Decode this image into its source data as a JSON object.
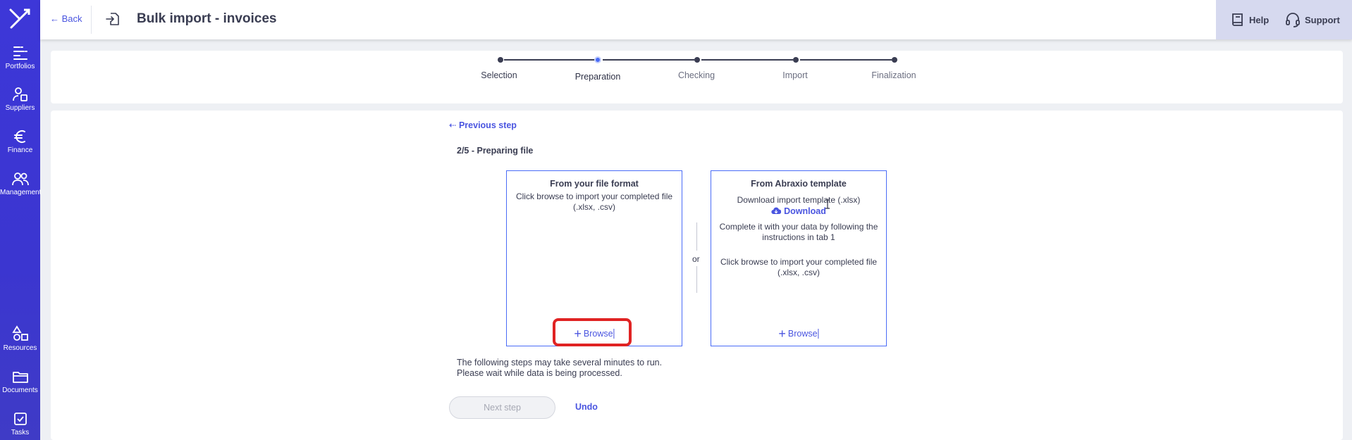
{
  "header": {
    "back_label": "Back",
    "title": "Bulk import - invoices",
    "help_label": "Help",
    "support_label": "Support"
  },
  "sidebar": {
    "items": [
      {
        "label": "Portfolios",
        "icon": "portfolios-icon"
      },
      {
        "label": "Suppliers",
        "icon": "suppliers-icon"
      },
      {
        "label": "Finance",
        "icon": "euro-icon"
      },
      {
        "label": "Management",
        "icon": "users-icon"
      },
      {
        "label": "Resources",
        "icon": "shapes-icon"
      },
      {
        "label": "Documents",
        "icon": "folder-icon"
      },
      {
        "label": "Tasks",
        "icon": "tasks-icon"
      }
    ]
  },
  "stepper": {
    "steps": [
      {
        "label": "Selection",
        "state": "done"
      },
      {
        "label": "Preparation",
        "state": "active"
      },
      {
        "label": "Checking",
        "state": "pending"
      },
      {
        "label": "Import",
        "state": "pending"
      },
      {
        "label": "Finalization",
        "state": "pending"
      }
    ]
  },
  "main": {
    "previous_step_label": "Previous step",
    "section_title": "2/5 - Preparing file",
    "own_format": {
      "title": "From your file format",
      "text": "Click browse to import your completed file (.xlsx, .csv)",
      "browse_label": "Browse"
    },
    "or_label": "or",
    "template": {
      "title": "From Abraxio template",
      "download_text": "Download import template (.xlsx)",
      "download_label": "Download",
      "complete_text": "Complete it with your data by following the instructions in tab 1",
      "browse_text": "Click browse to import your completed file (.xlsx, .csv)",
      "browse_label": "Browse"
    },
    "note_line1": "The following steps may take several minutes to run.",
    "note_line2": "Please wait while data is being processed.",
    "next_step_label": "Next step",
    "undo_label": "Undo"
  },
  "colors": {
    "sidebar": "#3d37d8",
    "accent": "#4a55e0",
    "highlight": "#e02323"
  }
}
